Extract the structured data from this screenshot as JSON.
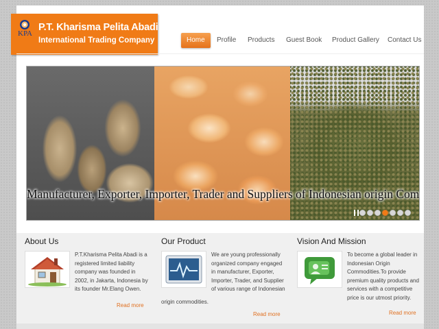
{
  "header": {
    "logo_mark_text": "KPA",
    "title": "P.T. Kharisma Pelita Abadi",
    "subtitle": "International Trading Company"
  },
  "nav": {
    "items": [
      {
        "label": "Home",
        "active": true
      },
      {
        "label": "Profile",
        "active": false
      },
      {
        "label": "Products",
        "active": false
      },
      {
        "label": "Guest Book",
        "active": false
      },
      {
        "label": "Product Gallery",
        "active": false
      },
      {
        "label": "Contact Us",
        "active": false
      }
    ]
  },
  "slider": {
    "caption": "Manufacturer,  Exporter,  Importer,  Trader and Suppliers of Indonesian origin Commodities.",
    "dot_count": 7,
    "active_dot": 3
  },
  "sections": [
    {
      "heading": "About Us",
      "icon": "house-icon",
      "text": "P.T.Kharisma Pelita Abadi is a registered limited liability company was founded in 2002, in Jakarta, Indonesia by its founder Mr.Elang Owen.",
      "read_more": "Read more"
    },
    {
      "heading": "Our Product",
      "icon": "monitor-pulse-icon",
      "text": "We are young professionally organized company engaged in manufacturer, Exporter, Importer, Trader, and Supplier of  various range of Indonesian",
      "text_tail": "origin commodities.",
      "read_more": "Read more"
    },
    {
      "heading": "Vision And Mission",
      "icon": "chat-people-icon",
      "text": "To become a global leader in Indonesian Origin Commodities.To provide premium quality products and services with a competitive price is our utmost priority.",
      "read_more": "Read more"
    }
  ],
  "colors": {
    "accent": "#f07b16",
    "background": "#c9c9c9",
    "link": "#e07020"
  }
}
